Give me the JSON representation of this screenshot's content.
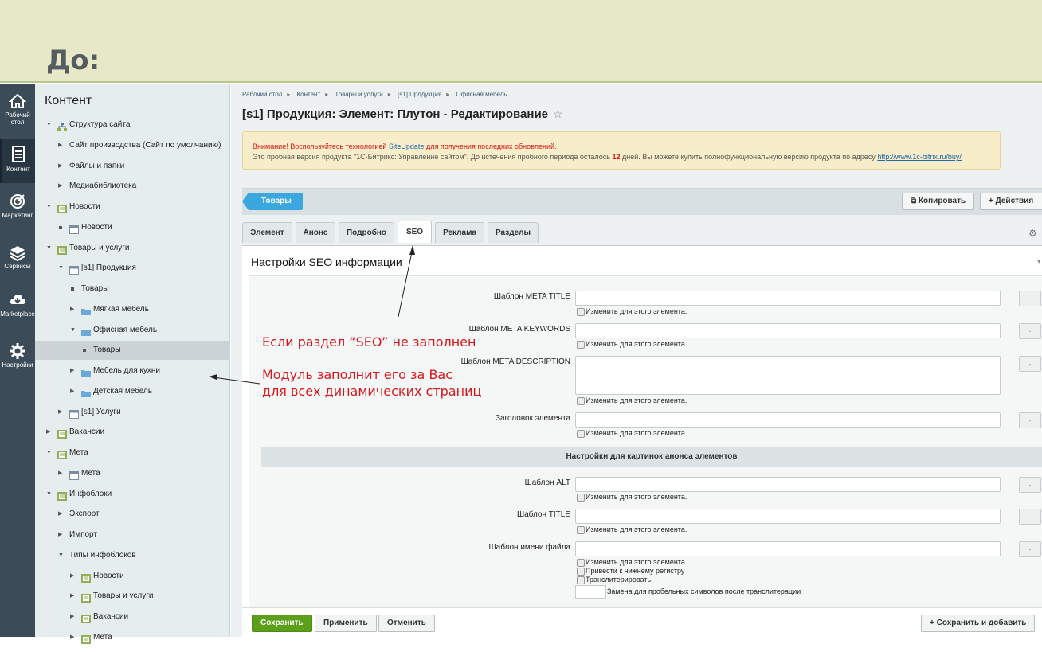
{
  "banner": {
    "title": "До:"
  },
  "leftbar": {
    "items": [
      {
        "label": "Рабочий стол",
        "icon": "home-icon"
      },
      {
        "label": "Контент",
        "icon": "document-icon"
      },
      {
        "label": "Маркетинг",
        "icon": "target-icon"
      },
      {
        "label": "Сервисы",
        "icon": "layers-icon"
      },
      {
        "label": "Marketplace",
        "icon": "cloud-download-icon"
      },
      {
        "label": "Настройки",
        "icon": "gear-icon"
      }
    ]
  },
  "tree": {
    "title": "Контент",
    "items": [
      {
        "label": "Структура сайта"
      },
      {
        "label": "Сайт производства (Сайт по умолчанию)"
      },
      {
        "label": "Файлы и папки"
      },
      {
        "label": "Медиабиблиотека"
      },
      {
        "label": "Новости"
      },
      {
        "label": "Новости"
      },
      {
        "label": "Товары и услуги"
      },
      {
        "label": "[s1] Продукция"
      },
      {
        "label": "Товары"
      },
      {
        "label": "Мягкая мебель"
      },
      {
        "label": "Офисная мебель"
      },
      {
        "label": "Товары"
      },
      {
        "label": "Мебель для кухни"
      },
      {
        "label": "Детская мебель"
      },
      {
        "label": "[s1] Услуги"
      },
      {
        "label": "Вакансии"
      },
      {
        "label": "Мета"
      },
      {
        "label": "Мета"
      },
      {
        "label": "Инфоблоки"
      },
      {
        "label": "Экспорт"
      },
      {
        "label": "Импорт"
      },
      {
        "label": "Типы инфоблоков"
      },
      {
        "label": "Новости"
      },
      {
        "label": "Товары и услуги"
      },
      {
        "label": "Вакансии"
      },
      {
        "label": "Мета"
      }
    ]
  },
  "breadcrumbs": [
    "Рабочий стол",
    "Контент",
    "Товары и услуги",
    "[s1] Продукция",
    "Офисная мебель"
  ],
  "page": {
    "title": "[s1] Продукция: Элемент: Плутон - Редактирование"
  },
  "alert": {
    "line1_prefix": "Внимание! Воспользуйтесь технологией ",
    "line1_link": "SiteUpdate",
    "line1_suffix": " для получения последних обновлений.",
    "line2_prefix": "Это пробная версия продукта \"1С-Битрикс: Управление сайтом\". До истечения пробного периода осталось ",
    "line2_days": "12",
    "line2_mid": " дней. Вы можете купить полнофункциональную версию продукта по адресу ",
    "line2_link": "http://www.1c-bitrix.ru/buy/"
  },
  "toolbar": {
    "label": "Товары",
    "copy": "Копировать",
    "actions": "Действия"
  },
  "tabs": [
    "Элемент",
    "Анонс",
    "Подробно",
    "SEO",
    "Реклама",
    "Разделы"
  ],
  "seo": {
    "title": "Настройки SEO информации",
    "change_label": "Изменить для этого элемента.",
    "ellipsis": "...",
    "fields": [
      {
        "label": "Шаблон META TITLE"
      },
      {
        "label": "Шаблон META KEYWORDS"
      },
      {
        "label": "Шаблон META DESCRIPTION"
      },
      {
        "label": "Заголовок элемента"
      }
    ],
    "pictures_header": "Настройки для картинок анонса элементов",
    "picture_fields": [
      {
        "label": "Шаблон ALT"
      },
      {
        "label": "Шаблон TITLE"
      },
      {
        "label": "Шаблон имени файла"
      }
    ],
    "lowercase": "Привести к нижнему регистру",
    "transliterate": "Транслитерировать",
    "space_replace": "Замена для пробельных символов после транслитерации"
  },
  "footer": {
    "save": "Сохранить",
    "apply": "Применить",
    "cancel": "Отменить",
    "save_add": "Сохранить и добавить"
  },
  "annotations": {
    "line1": "Если раздел “SEO” не заполнен",
    "line2": "Модуль заполнит его за Вас",
    "line3": "для всех динамических страниц"
  }
}
